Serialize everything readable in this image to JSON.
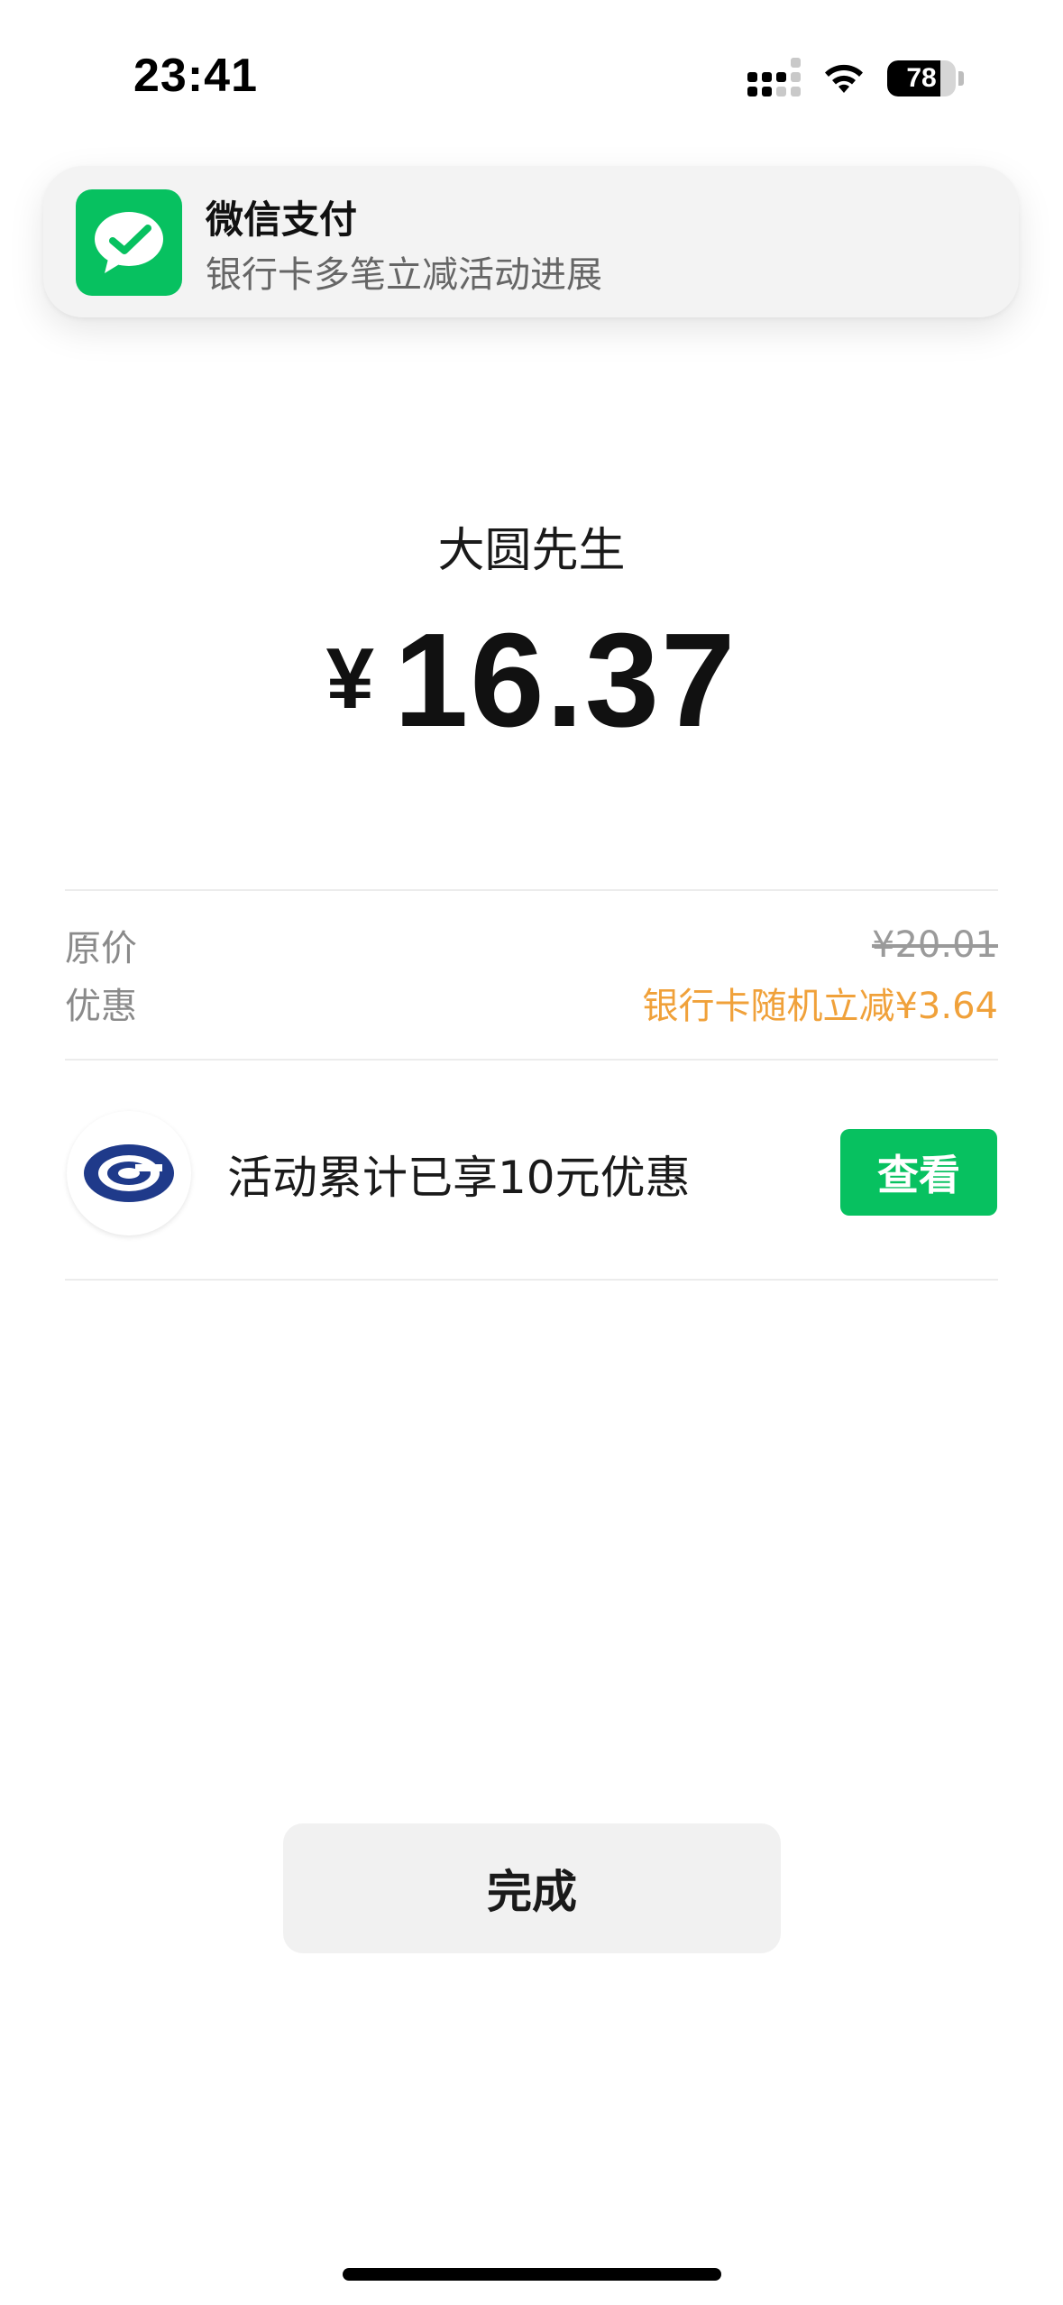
{
  "status_bar": {
    "time": "23:41",
    "battery_level": 78,
    "battery_label": "78",
    "signal_icon": "cellular-signal-icon",
    "wifi_icon": "wifi-icon"
  },
  "notification": {
    "app_icon": "wechat-pay-icon",
    "title": "微信支付",
    "body": "银行卡多笔立减活动进展"
  },
  "payment": {
    "payee": "大圆先生",
    "currency_symbol": "¥",
    "amount": "16.37"
  },
  "details": {
    "original_label": "原价",
    "original_value": "¥20.01",
    "discount_label": "优惠",
    "discount_value": "银行卡随机立减¥3.64"
  },
  "activity": {
    "logo_icon": "bank-logo-icon",
    "text": "活动累计已享10元优惠",
    "button_label": "查看"
  },
  "footer": {
    "done_label": "完成"
  },
  "colors": {
    "brand_green": "#07c160",
    "discount_orange": "#f0a13a",
    "bank_blue": "#1f3a8a"
  }
}
